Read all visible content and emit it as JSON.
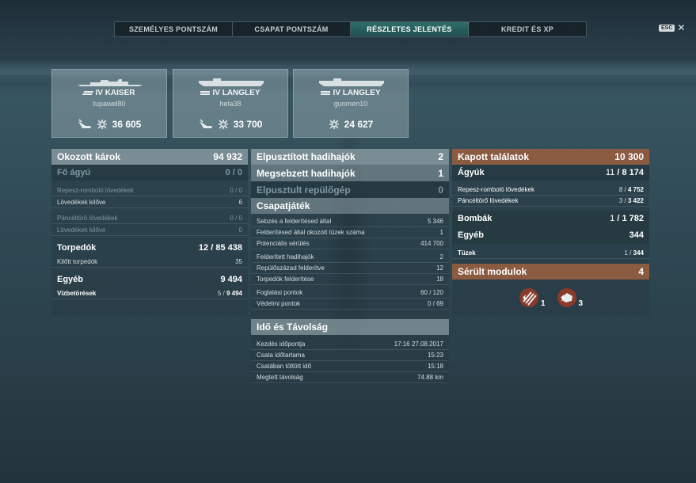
{
  "tabs": [
    "SZEMÉLYES PONTSZÁM",
    "CSAPAT PONTSZÁM",
    "RÉSZLETES JELENTÉS",
    "KREDIT ÉS XP"
  ],
  "active_tab": "RÉSZLETES JELENTÉS",
  "esc_label": "ESC",
  "close_label": "✕",
  "players": [
    {
      "ship": "IV KAISER",
      "player": "tupawel80",
      "damage": "36 605",
      "class_icon": "battleship-icon"
    },
    {
      "ship": "IV LANGLEY",
      "player": "hela38",
      "damage": "33 700",
      "class_icon": "carrier-icon"
    },
    {
      "ship": "IV LANGLEY",
      "player": "gunmen10",
      "damage": "24 627",
      "class_icon": "carrier-icon"
    }
  ],
  "left": {
    "damage_label": "Okozott károk",
    "damage_value": "94 932",
    "main_label": "Fő ágyú",
    "main_value": "0 / 0",
    "he_label": "Repesz-romboló lövedékek",
    "he_value": "0 / 0",
    "he_fired_label": "Lövedékek kilőve",
    "he_fired_value": "6",
    "ap_label": "Páncéltörő lövedékek",
    "ap_value": "0 / 0",
    "ap_fired_label": "Lövedékek kilőve",
    "ap_fired_value": "0",
    "torp_label": "Torpedók",
    "torp_hits": "12",
    "torp_dmg": "85 438",
    "torp_fired_label": "Kilőtt torpedók",
    "torp_fired_value": "35",
    "other_label": "Egyéb",
    "other_value": "9 494",
    "flood_label": "Vízbetörések",
    "flood_hits": "5",
    "flood_dmg": "9 494"
  },
  "middle": {
    "destroyed_label": "Elpusztított hadihajók",
    "destroyed_value": "2",
    "damaged_label": "Megsebzett hadihajók",
    "damaged_value": "1",
    "planes_label": "Elpusztult repülőgép",
    "planes_value": "0",
    "team_label": "Csapatjáték",
    "spot_dmg_label": "Sebzés a felderítésed által",
    "spot_dmg_value": "5 346",
    "fire_spot_label": "Felderítésed által okozott tüzek száma",
    "fire_spot_value": "1",
    "potential_label": "Potenciális sérülés",
    "potential_value": "414 700",
    "spotted_label": "Felderített hadihajók",
    "spotted_value": "2",
    "sq_spotted_label": "Repülőszázad felderítve",
    "sq_spotted_value": "12",
    "torp_spotted_label": "Torpedók felderítése",
    "torp_spotted_value": "18",
    "capture_label": "Foglalási pontok",
    "capture_value": "60 / 120",
    "defense_label": "Védelmi pontok",
    "defense_value": "0 / 69",
    "time_label": "Idő és Távolság",
    "start_label": "Kezdés időpontja",
    "start_value": "17:16  27.08.2017",
    "duration_label": "Csata időtartama",
    "duration_value": "15:23",
    "in_battle_label": "Csatában töltött idő",
    "in_battle_value": "15:18",
    "distance_label": "Megtett távolság",
    "distance_value": "74.88 km"
  },
  "right": {
    "received_label": "Kapott találatok",
    "received_value": "10 300",
    "guns_label": "Ágyúk",
    "guns_hits": "11",
    "guns_dmg": "8 174",
    "he_label": "Repesz-romboló lövedékek",
    "he_hits": "8",
    "he_dmg": "4 752",
    "ap_label": "Páncéltörő lövedékek",
    "ap_hits": "3",
    "ap_dmg": "3 422",
    "bombs_label": "Bombák",
    "bombs_hits": "1",
    "bombs_dmg": "1 782",
    "other_label": "Egyéb",
    "other_value": "344",
    "fires_label": "Tüzek",
    "fires_hits": "1",
    "fires_dmg": "344",
    "modules_label": "Sérült modulok",
    "modules_value": "4",
    "module_counts": [
      "1",
      "3"
    ],
    "accent_color": "#8a5a41"
  }
}
